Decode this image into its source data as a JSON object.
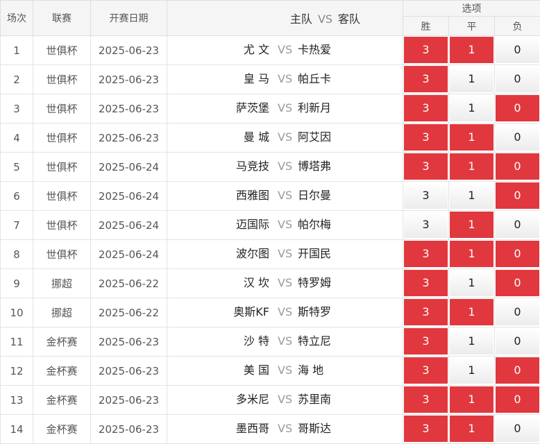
{
  "header": {
    "no": "场次",
    "league": "联赛",
    "date": "开赛日期",
    "home": "主队",
    "vs": "VS",
    "away": "客队",
    "options": "选项",
    "win": "胜",
    "draw": "平",
    "lose": "负"
  },
  "colors": {
    "selected": "#e0383e",
    "unselected": "#f2f2f2"
  },
  "rows": [
    {
      "no": "1",
      "league": "世俱杯",
      "date": "2025-06-23",
      "home": "尤 文",
      "vs": "VS",
      "away": "卡热爱",
      "win": "3",
      "draw": "1",
      "lose": "0",
      "win_sel": true,
      "draw_sel": true,
      "lose_sel": false
    },
    {
      "no": "2",
      "league": "世俱杯",
      "date": "2025-06-23",
      "home": "皇 马",
      "vs": "VS",
      "away": "帕丘卡",
      "win": "3",
      "draw": "1",
      "lose": "0",
      "win_sel": true,
      "draw_sel": false,
      "lose_sel": false
    },
    {
      "no": "3",
      "league": "世俱杯",
      "date": "2025-06-23",
      "home": "萨茨堡",
      "vs": "VS",
      "away": "利新月",
      "win": "3",
      "draw": "1",
      "lose": "0",
      "win_sel": true,
      "draw_sel": false,
      "lose_sel": true
    },
    {
      "no": "4",
      "league": "世俱杯",
      "date": "2025-06-23",
      "home": "曼 城",
      "vs": "VS",
      "away": "阿艾因",
      "win": "3",
      "draw": "1",
      "lose": "0",
      "win_sel": true,
      "draw_sel": true,
      "lose_sel": false
    },
    {
      "no": "5",
      "league": "世俱杯",
      "date": "2025-06-24",
      "home": "马竞技",
      "vs": "VS",
      "away": "博塔弗",
      "win": "3",
      "draw": "1",
      "lose": "0",
      "win_sel": true,
      "draw_sel": true,
      "lose_sel": true
    },
    {
      "no": "6",
      "league": "世俱杯",
      "date": "2025-06-24",
      "home": "西雅图",
      "vs": "VS",
      "away": "日尔曼",
      "win": "3",
      "draw": "1",
      "lose": "0",
      "win_sel": false,
      "draw_sel": false,
      "lose_sel": true
    },
    {
      "no": "7",
      "league": "世俱杯",
      "date": "2025-06-24",
      "home": "迈国际",
      "vs": "VS",
      "away": "帕尔梅",
      "win": "3",
      "draw": "1",
      "lose": "0",
      "win_sel": false,
      "draw_sel": true,
      "lose_sel": false
    },
    {
      "no": "8",
      "league": "世俱杯",
      "date": "2025-06-24",
      "home": "波尔图",
      "vs": "VS",
      "away": "开国民",
      "win": "3",
      "draw": "1",
      "lose": "0",
      "win_sel": true,
      "draw_sel": true,
      "lose_sel": true
    },
    {
      "no": "9",
      "league": "挪超",
      "date": "2025-06-22",
      "home": "汉 坎",
      "vs": "VS",
      "away": "特罗姆",
      "win": "3",
      "draw": "1",
      "lose": "0",
      "win_sel": true,
      "draw_sel": false,
      "lose_sel": true
    },
    {
      "no": "10",
      "league": "挪超",
      "date": "2025-06-22",
      "home": "奥斯KF",
      "vs": "VS",
      "away": "斯特罗",
      "win": "3",
      "draw": "1",
      "lose": "0",
      "win_sel": true,
      "draw_sel": true,
      "lose_sel": false
    },
    {
      "no": "11",
      "league": "金杯赛",
      "date": "2025-06-23",
      "home": "沙 特",
      "vs": "VS",
      "away": "特立尼",
      "win": "3",
      "draw": "1",
      "lose": "0",
      "win_sel": true,
      "draw_sel": false,
      "lose_sel": false
    },
    {
      "no": "12",
      "league": "金杯赛",
      "date": "2025-06-23",
      "home": "美 国",
      "vs": "VS",
      "away": "海 地",
      "win": "3",
      "draw": "1",
      "lose": "0",
      "win_sel": true,
      "draw_sel": false,
      "lose_sel": true
    },
    {
      "no": "13",
      "league": "金杯赛",
      "date": "2025-06-23",
      "home": "多米尼",
      "vs": "VS",
      "away": "苏里南",
      "win": "3",
      "draw": "1",
      "lose": "0",
      "win_sel": true,
      "draw_sel": true,
      "lose_sel": true
    },
    {
      "no": "14",
      "league": "金杯赛",
      "date": "2025-06-23",
      "home": "墨西哥",
      "vs": "VS",
      "away": "哥斯达",
      "win": "3",
      "draw": "1",
      "lose": "0",
      "win_sel": true,
      "draw_sel": true,
      "lose_sel": false
    }
  ]
}
